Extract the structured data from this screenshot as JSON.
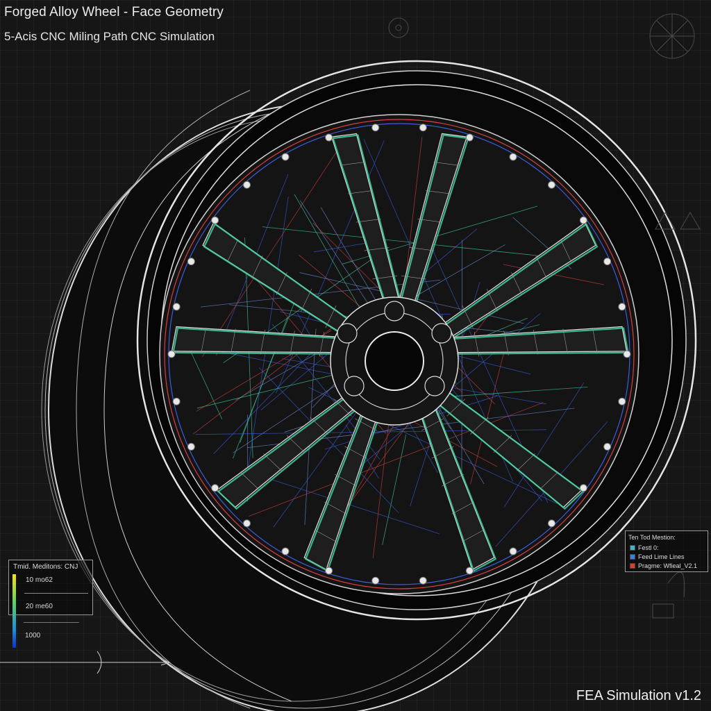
{
  "header": {
    "title": "Forged Alloy Wheel - Face Geometry",
    "subtitle": "5-Acis CNC Miling Path  CNC Simulation"
  },
  "footer": {
    "version": "FEA Simulation v1.2"
  },
  "legend_left": {
    "title": "Tmid. Meditons: CNJ",
    "row1": "10  mo62",
    "row2": "20  me60",
    "row3": "1000"
  },
  "legend_right": {
    "title": "Ten Tod Mestion:",
    "items": [
      {
        "label": "Festl 0:",
        "color": "#3fb6c8"
      },
      {
        "label": "Feed Lime Lines",
        "color": "#3f7fd8"
      },
      {
        "label": "Pragme: Wfieal_V2.1",
        "color": "#d8402a"
      }
    ]
  },
  "colors": {
    "background": "#161616",
    "wireframe": "#e8e8e8",
    "toolpath_green": "#3fd0a0",
    "toolpath_blue": "#3a5fe0",
    "toolpath_red": "#d84040"
  }
}
